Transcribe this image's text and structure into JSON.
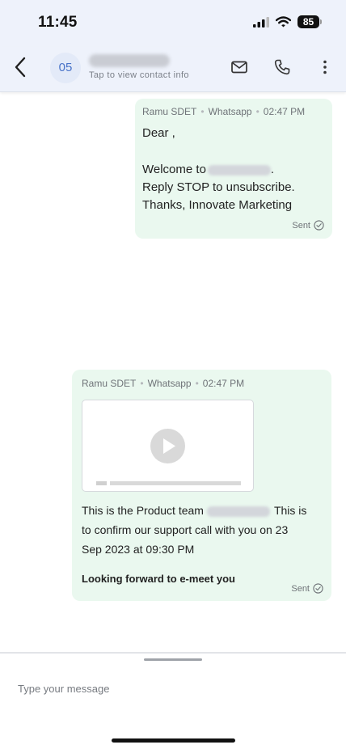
{
  "status_bar": {
    "time": "11:45",
    "battery": "85"
  },
  "header": {
    "avatar_initials": "05",
    "contact_sub": "Tap to view contact info",
    "icons": [
      "back-icon",
      "mail-icon",
      "phone-icon",
      "more-vertical-icon"
    ]
  },
  "messages": [
    {
      "sender": "Ramu SDET",
      "channel": "Whatsapp",
      "time": "02:47 PM",
      "greeting": "Dear ,",
      "welcome": "Welcome to",
      "welcome_end": ".",
      "reply": "Reply STOP to unsubscribe.",
      "thanks": "Thanks, Innovate Marketing",
      "status": "Sent"
    },
    {
      "sender": "Ramu SDET",
      "channel": "Whatsapp",
      "time": "02:47 PM",
      "line1_start": "This is the Product team",
      "line1_end": "This is",
      "line2": "to confirm our support call with you on 23",
      "line3": "Sep 2023 at 09:30 PM",
      "closing": "Looking forward to e-meet you",
      "status": "Sent"
    }
  ],
  "composer": {
    "placeholder": "Type your message"
  },
  "colors": {
    "bubble": "#eaf8ef",
    "header_bg": "#eef2fb",
    "avatar_text": "#4a74c9"
  }
}
